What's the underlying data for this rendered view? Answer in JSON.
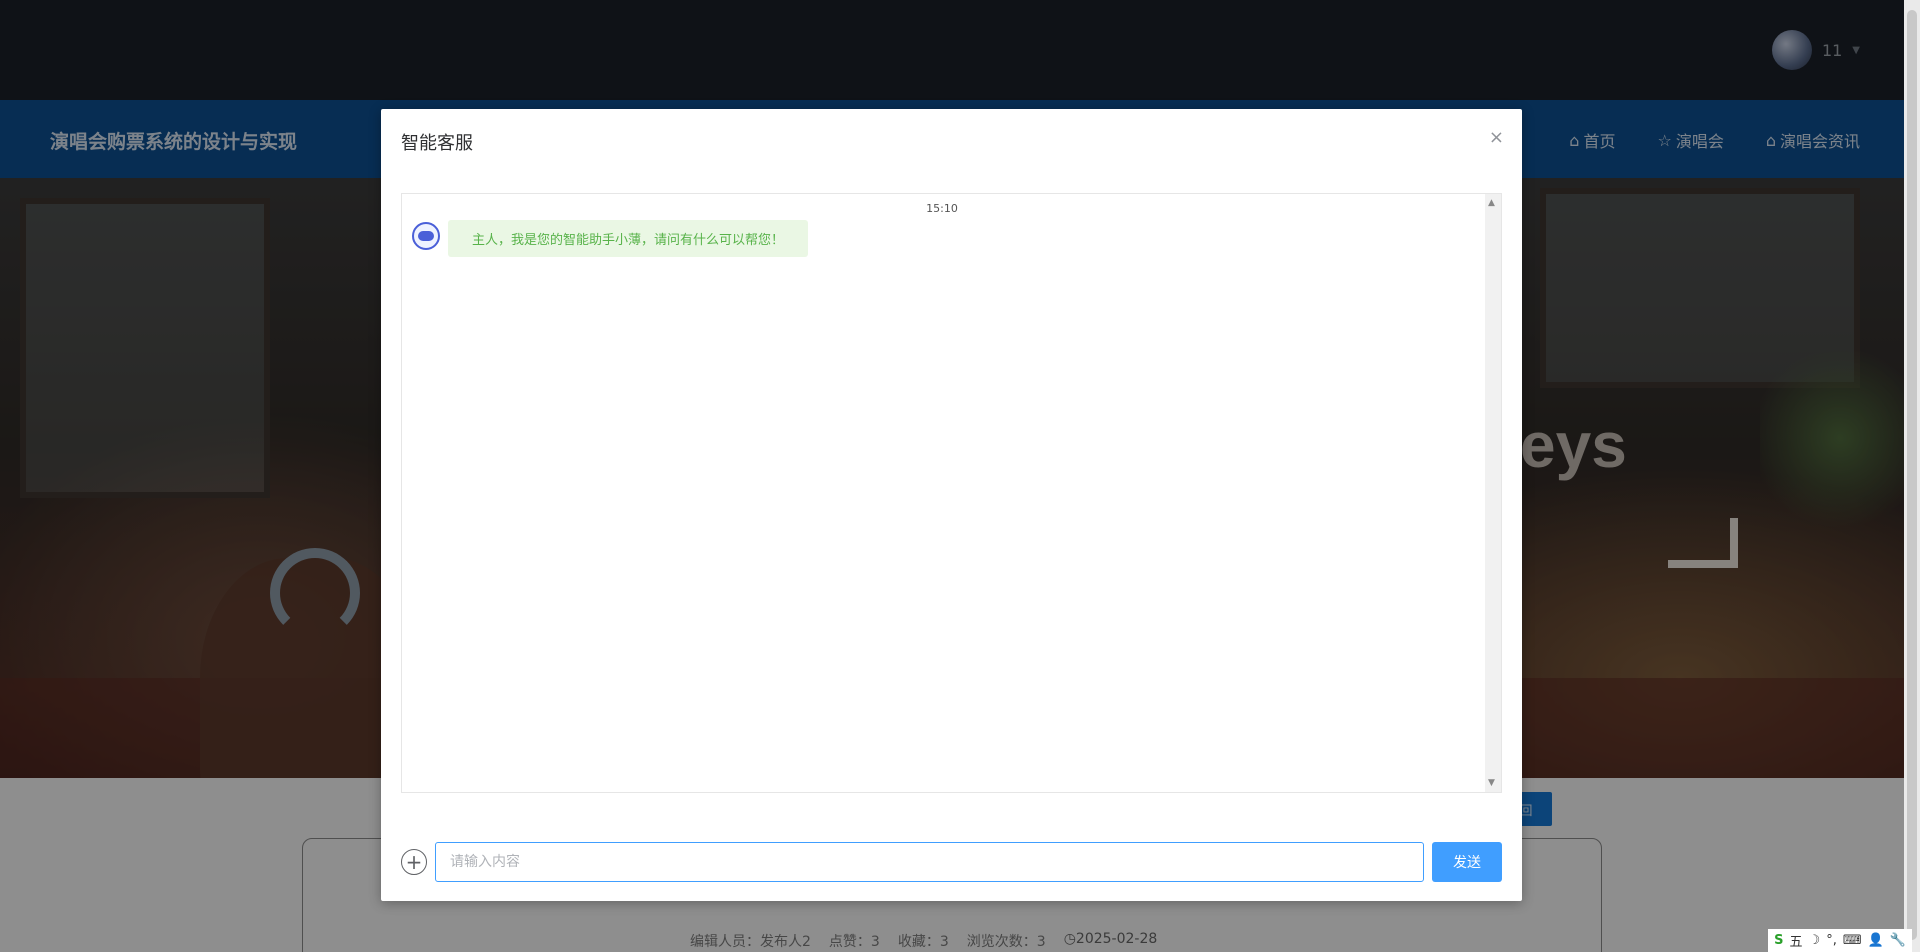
{
  "header": {
    "username": "11",
    "brand": "演唱会购票系统的设计与实现",
    "nav": [
      {
        "icon": "home-icon",
        "label": "首页"
      },
      {
        "icon": "star-icon",
        "label": "演唱会"
      },
      {
        "icon": "bag-icon",
        "label": "演唱会资讯"
      }
    ]
  },
  "hero": {
    "text": "eys"
  },
  "page": {
    "back_label": "回",
    "meta": {
      "editor": "编辑人员：发布人2",
      "likes": "点赞：3",
      "favorites": "收藏：3",
      "views": "浏览次数：3",
      "date": "2025-02-28"
    }
  },
  "modal": {
    "title": "智能客服",
    "close": "×",
    "timestamp": "15:10",
    "message": "主人，我是您的智能助手小薄，请问有什么可以帮您！",
    "input_placeholder": "请输入内容",
    "send_label": "发送"
  },
  "ime": {
    "items": [
      "S",
      "五",
      "☽",
      "°,",
      "⌨",
      "👤",
      "🔧"
    ]
  }
}
